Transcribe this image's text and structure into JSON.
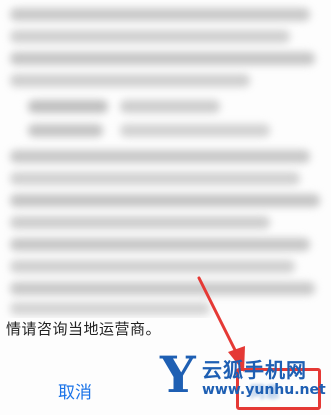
{
  "dialog": {
    "notice_tail": "情请咨询当地运营商。",
    "cancel_label": "取消",
    "confirm_label": "同意"
  },
  "watermark": {
    "logo_letter": "Y",
    "site_name": "云狐手机网",
    "url": "www.yunhu.net"
  },
  "annotation": {
    "arrow_color": "#e53935",
    "box_color": "#e53935"
  }
}
